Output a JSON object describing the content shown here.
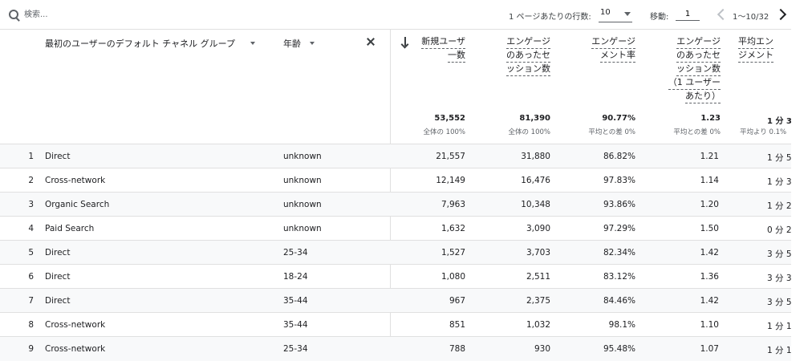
{
  "toolbar": {
    "search_placeholder": "検索...",
    "rows_per_page_label": "1 ページあたりの行数:",
    "rows_per_page_value": "10",
    "goto_label": "移動:",
    "goto_value": "1",
    "page_range": "1〜10/32"
  },
  "dimensions": {
    "primary_label": "最初のユーザーのデフォルト チャネル グループ",
    "secondary_label": "年齢"
  },
  "metrics": [
    {
      "label_lines": [
        "新規ユーザ",
        "一数"
      ],
      "total": "53,552",
      "total_sub": "全体の 100%"
    },
    {
      "label_lines": [
        "エンゲージ",
        "のあったセ",
        "ッション数"
      ],
      "total": "81,390",
      "total_sub": "全体の 100%"
    },
    {
      "label_lines": [
        "エンゲージ",
        "メント率"
      ],
      "total": "90.77%",
      "total_sub": "平均との差 0%"
    },
    {
      "label_lines": [
        "エンゲージ",
        "のあったセ",
        "ッション数",
        "（1 ユーザー",
        "あたり）"
      ],
      "total": "1.23",
      "total_sub": "平均との差 0%"
    },
    {
      "label_lines": [
        "平均エン",
        "ジメント"
      ],
      "total": "1 分 3",
      "total_sub": "平均より 0.1%"
    }
  ],
  "rows": [
    {
      "index": "1",
      "channel": "Direct",
      "age": "unknown",
      "new_users": "21,557",
      "engaged_sessions": "31,880",
      "engagement_rate": "86.82%",
      "engaged_per_user": "1.21",
      "avg_time": "1 分 5"
    },
    {
      "index": "2",
      "channel": "Cross-network",
      "age": "unknown",
      "new_users": "12,149",
      "engaged_sessions": "16,476",
      "engagement_rate": "97.83%",
      "engaged_per_user": "1.14",
      "avg_time": "1 分 3"
    },
    {
      "index": "3",
      "channel": "Organic Search",
      "age": "unknown",
      "new_users": "7,963",
      "engaged_sessions": "10,348",
      "engagement_rate": "93.86%",
      "engaged_per_user": "1.20",
      "avg_time": "1 分 2"
    },
    {
      "index": "4",
      "channel": "Paid Search",
      "age": "unknown",
      "new_users": "1,632",
      "engaged_sessions": "3,090",
      "engagement_rate": "97.29%",
      "engaged_per_user": "1.50",
      "avg_time": "0 分 2"
    },
    {
      "index": "5",
      "channel": "Direct",
      "age": "25-34",
      "new_users": "1,527",
      "engaged_sessions": "3,703",
      "engagement_rate": "82.34%",
      "engaged_per_user": "1.42",
      "avg_time": "3 分 5"
    },
    {
      "index": "6",
      "channel": "Direct",
      "age": "18-24",
      "new_users": "1,080",
      "engaged_sessions": "2,511",
      "engagement_rate": "83.12%",
      "engaged_per_user": "1.36",
      "avg_time": "3 分 3"
    },
    {
      "index": "7",
      "channel": "Direct",
      "age": "35-44",
      "new_users": "967",
      "engaged_sessions": "2,375",
      "engagement_rate": "84.46%",
      "engaged_per_user": "1.42",
      "avg_time": "3 分 5"
    },
    {
      "index": "8",
      "channel": "Cross-network",
      "age": "35-44",
      "new_users": "851",
      "engaged_sessions": "1,032",
      "engagement_rate": "98.1%",
      "engaged_per_user": "1.10",
      "avg_time": "1 分 1"
    },
    {
      "index": "9",
      "channel": "Cross-network",
      "age": "25-34",
      "new_users": "788",
      "engaged_sessions": "930",
      "engagement_rate": "95.48%",
      "engaged_per_user": "1.07",
      "avg_time": "1 分 1"
    }
  ]
}
